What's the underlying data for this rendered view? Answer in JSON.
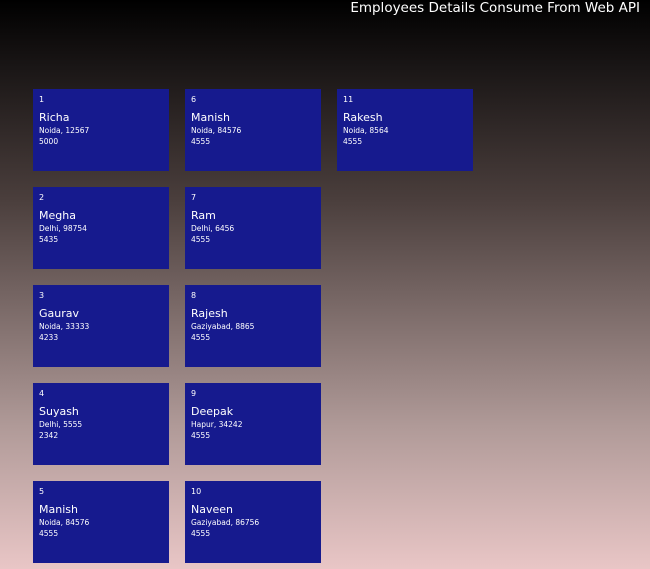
{
  "header": {
    "title": "Employees Details Consume From Web API"
  },
  "employees": [
    {
      "id": "1",
      "name": "Richa",
      "address": "Noida, 12567",
      "salary": "5000"
    },
    {
      "id": "2",
      "name": "Megha",
      "address": "Delhi, 98754",
      "salary": "5435"
    },
    {
      "id": "3",
      "name": "Gaurav",
      "address": "Noida, 33333",
      "salary": "4233"
    },
    {
      "id": "4",
      "name": "Suyash",
      "address": "Delhi, 5555",
      "salary": "2342"
    },
    {
      "id": "5",
      "name": "Manish",
      "address": "Noida, 84576",
      "salary": "4555"
    },
    {
      "id": "6",
      "name": "Manish",
      "address": "Noida, 84576",
      "salary": "4555"
    },
    {
      "id": "7",
      "name": "Ram",
      "address": "Delhi, 6456",
      "salary": "4555"
    },
    {
      "id": "8",
      "name": "Rajesh",
      "address": "Gaziyabad, 8865",
      "salary": "4555"
    },
    {
      "id": "9",
      "name": "Deepak",
      "address": "Hapur, 34242",
      "salary": "4555"
    },
    {
      "id": "10",
      "name": "Naveen",
      "address": "Gaziyabad, 86756",
      "salary": "4555"
    },
    {
      "id": "11",
      "name": "Rakesh",
      "address": "Noida, 8564",
      "salary": "4555"
    }
  ]
}
